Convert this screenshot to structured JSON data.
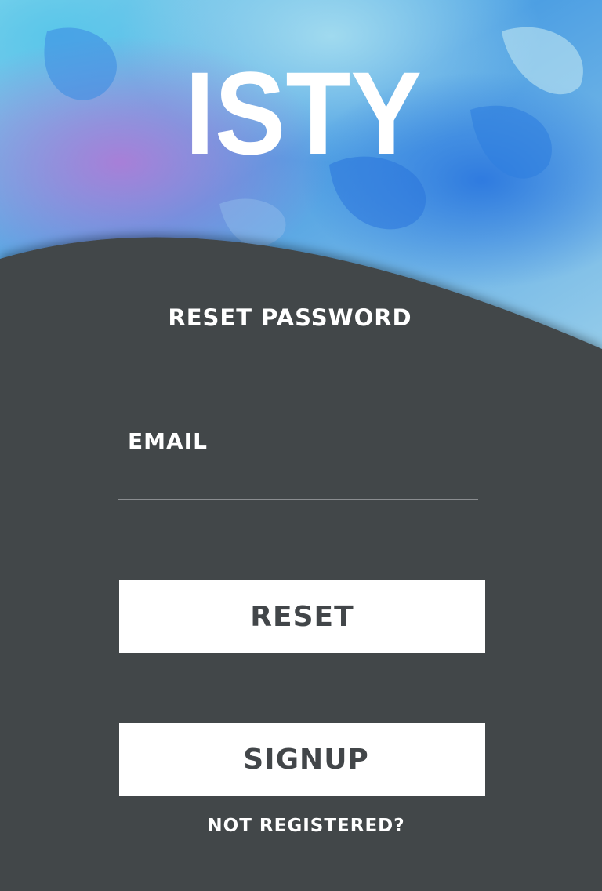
{
  "app": {
    "logo_text": "ISTY"
  },
  "form": {
    "title": "RESET PASSWORD",
    "email_label": "EMAIL",
    "email_value": "",
    "reset_label": "RESET",
    "signup_label": "SIGNUP",
    "not_registered_text": "NOT REGISTERED?"
  },
  "colors": {
    "panel": "#424649",
    "button_bg": "#ffffff",
    "button_text": "#424649",
    "input_underline": "#8a8d90",
    "hero_blue": "#2f86e0",
    "hero_light": "#8fd3ee",
    "hero_purple": "#9a74d8"
  }
}
